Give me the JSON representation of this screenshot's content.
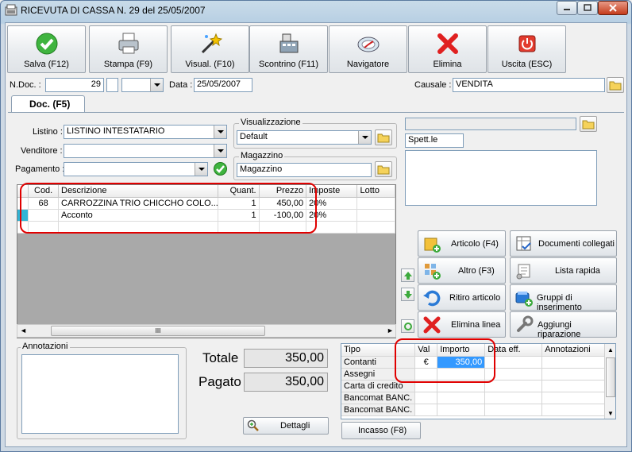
{
  "window": {
    "title": "RICEVUTA DI CASSA N. 29  del 25/05/2007"
  },
  "toolbar": [
    {
      "name": "salva-button",
      "label": "Salva (F12)",
      "icon": "check-icon"
    },
    {
      "name": "stampa-button",
      "label": "Stampa (F9)",
      "icon": "printer-icon"
    },
    {
      "name": "visual-button",
      "label": "Visual. (F10)",
      "icon": "magic-wand-icon"
    },
    {
      "name": "scontrino-button",
      "label": "Scontrino (F11)",
      "icon": "cash-register-icon"
    },
    {
      "name": "navigatore-button",
      "label": "Navigatore",
      "icon": "compass-icon"
    },
    {
      "name": "elimina-button",
      "label": "Elimina",
      "icon": "red-x-icon"
    },
    {
      "name": "uscita-button",
      "label": "Uscita (ESC)",
      "icon": "power-icon"
    }
  ],
  "header": {
    "ndoc_label": "N.Doc. :",
    "ndoc_value": "29",
    "data_label": "Data :",
    "data_value": "25/05/2007",
    "causale_label": "Causale :",
    "causale_value": "VENDITA"
  },
  "tab": {
    "label": "Doc. (F5)"
  },
  "form": {
    "listino_label": "Listino :",
    "listino_value": "LISTINO INTESTATARIO",
    "venditore_label": "Venditore :",
    "venditore_value": "",
    "pagamento_label": "Pagamento :",
    "pagamento_value": "",
    "visualizzazione_title": "Visualizzazione",
    "visualizzazione_value": "Default",
    "magazzino_title": "Magazzino",
    "magazzino_value": "Magazzino"
  },
  "customer": {
    "top_value": "",
    "spett_value": "Spett.le"
  },
  "grid": {
    "columns": [
      "Cod.",
      "Descrizione",
      "Quant.",
      "Prezzo",
      "Imposte",
      "Lotto"
    ],
    "rows": [
      {
        "cod": "68",
        "descrizione": "CARROZZINA TRIO CHICCHO COLO...",
        "quant": "1",
        "prezzo": "450,00",
        "imposte": "20%",
        "lotto": ""
      },
      {
        "cod": "",
        "descrizione": "Acconto",
        "quant": "1",
        "prezzo": "-100,00",
        "imposte": "20%",
        "lotto": ""
      }
    ],
    "scroll_grip": "III"
  },
  "actions": [
    {
      "name": "articolo-button",
      "label": "Articolo (F4)",
      "icon": "box-add-icon"
    },
    {
      "name": "documenti-collegati-button",
      "label": "Documenti collegati",
      "icon": "table-check-icon"
    },
    {
      "name": "altro-button",
      "label": "Altro (F3)",
      "icon": "grid-add-icon"
    },
    {
      "name": "lista-rapida-button",
      "label": "Lista rapida",
      "icon": "scroll-list-icon"
    },
    {
      "name": "ritiro-articolo-button",
      "label": "Ritiro articolo",
      "icon": "undo-arrow-icon"
    },
    {
      "name": "gruppi-inserimento-button",
      "label": "Gruppi di inserimento",
      "icon": "group-add-icon"
    },
    {
      "name": "elimina-linea-button",
      "label": "Elimina linea",
      "icon": "red-x-icon"
    },
    {
      "name": "aggiungi-riparazione-button",
      "label": "Aggiungi riparazione",
      "icon": "wrench-icon"
    }
  ],
  "annotazioni": {
    "title": "Annotazioni",
    "value": ""
  },
  "totals": {
    "totale_label": "Totale",
    "totale_value": "350,00",
    "pagato_label": "Pagato",
    "pagato_value": "350,00",
    "dettagli_label": "Dettagli"
  },
  "payments": {
    "columns": [
      "Tipo",
      "Val",
      "Importo",
      "Data eff.",
      "Annotazioni"
    ],
    "rows": [
      {
        "tipo": "Contanti",
        "val": "€",
        "importo": "350,00",
        "data": "",
        "note": ""
      },
      {
        "tipo": "Assegni",
        "val": "",
        "importo": "",
        "data": "",
        "note": ""
      },
      {
        "tipo": "Carta di credito",
        "val": "",
        "importo": "",
        "data": "",
        "note": ""
      },
      {
        "tipo": "Bancomat BANC.",
        "val": "",
        "importo": "",
        "data": "",
        "note": ""
      },
      {
        "tipo": "Bancomat BANC.",
        "val": "",
        "importo": "",
        "data": "",
        "note": ""
      }
    ],
    "incasso_label": "Incasso (F8)"
  },
  "colors": {
    "highlight": "#3399ff",
    "annotation_red": "#e00000"
  }
}
